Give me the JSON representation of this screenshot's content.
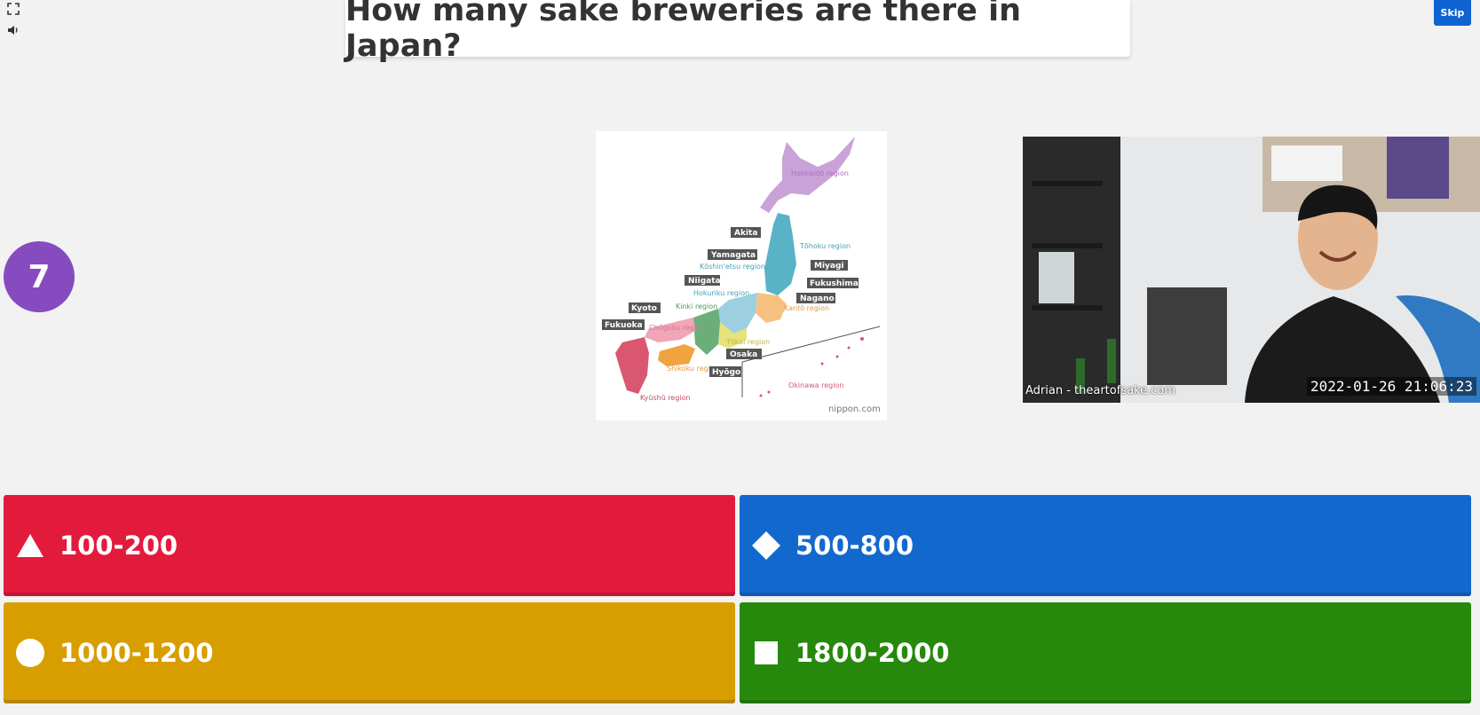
{
  "controls": {
    "fullscreen_icon": "fullscreen-icon",
    "sound_icon": "speaker-icon",
    "skip_label": "Skip"
  },
  "question": {
    "text": "How many sake breweries are there in Japan?"
  },
  "timer": {
    "value": "7",
    "color": "#864cbf"
  },
  "map": {
    "regions": {
      "hokkaido": "Hokkaidō region",
      "tohoku": "Tōhoku region",
      "koshinetsu": "Kōshin'etsu region",
      "hokuriku": "Hokuriku region",
      "kinki": "Kinki region",
      "kanto": "Kantō region",
      "chugoku": "Chūgoku region",
      "tokai": "Tōkai region",
      "shikoku": "Shikoku region",
      "kyushu": "Kyūshū region",
      "okinawa": "Okinawa region"
    },
    "prefectures": {
      "akita": "Akita",
      "yamagata": "Yamagata",
      "miyagi": "Miyagi",
      "niigata": "Niigata",
      "fukushima": "Fukushima",
      "nagano": "Nagano",
      "kyoto": "Kyoto",
      "fukuoka": "Fukuoka",
      "osaka": "Osaka",
      "hyogo": "Hyōgo"
    },
    "credit": "nippon.com"
  },
  "video": {
    "caption": "Adrian - theartofsake.com",
    "timestamp": "2022-01-26  21:06:23"
  },
  "answers": [
    {
      "label": "100-200",
      "shape": "triangle-icon",
      "color": "#e21b3c"
    },
    {
      "label": "500-800",
      "shape": "diamond-icon",
      "color": "#1368ce"
    },
    {
      "label": "1000-1200",
      "shape": "circle-icon",
      "color": "#d89e00"
    },
    {
      "label": "1800-2000",
      "shape": "square-icon",
      "color": "#26890c"
    }
  ]
}
